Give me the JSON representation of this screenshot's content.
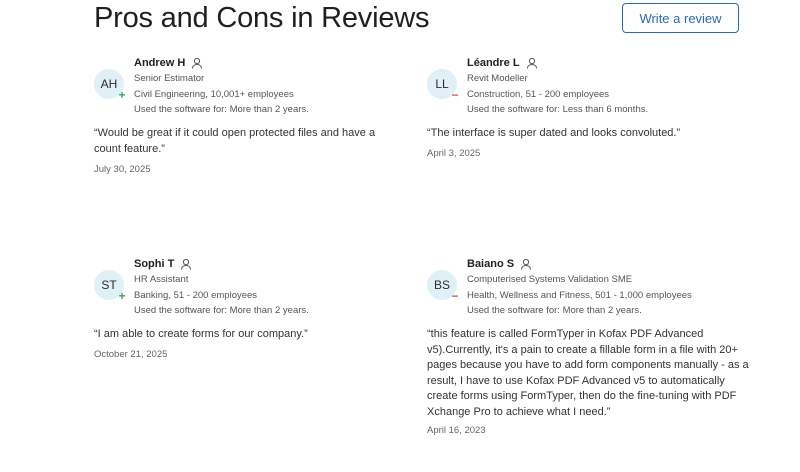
{
  "page": {
    "title": "Pros and Cons in Reviews",
    "write_review_label": "Write a review"
  },
  "reviews": [
    {
      "initials": "AH",
      "sign": "+",
      "name": "Andrew H",
      "role": "Senior Estimator",
      "company": "Civil Engineering, 10,001+ employees",
      "usage": "Used the software for: More than 2 years.",
      "quote": "“Would be great if it could open protected files and have a count feature.”",
      "date": "July 30, 2025"
    },
    {
      "initials": "LL",
      "sign": "−",
      "name": "Léandre L",
      "role": "Revit Modeller",
      "company": "Construction, 51 - 200 employees",
      "usage": "Used the software for: Less than 6 months.",
      "quote": "“The interface is super dated and looks convoluted.”",
      "date": "April 3, 2025"
    },
    {
      "initials": "ST",
      "sign": "+",
      "name": "Sophi T",
      "role": "HR Assistant",
      "company": "Banking, 51 - 200 employees",
      "usage": "Used the software for: More than 2 years.",
      "quote": "“I am able to create forms for our company.”",
      "date": "October 21, 2025"
    },
    {
      "initials": "BS",
      "sign": "−",
      "name": "Baiano S",
      "role": "Computerised Systems Validation SME",
      "company": "Health, Wellness and Fitness, 501 - 1,000 employees",
      "usage": "Used the software for: More than 2 years.",
      "quote": "“this feature is called FormTyper in Kofax PDF Advanced v5).Currently, it's a pain to create a fillable form in a file with 20+ pages because you have to add form components manually - as a result, I have to use Kofax PDF Advanced v5 to automatically create forms using FormTyper, then do the fine-tuning with PDF Xchange Pro to achieve what I need.”",
      "date": "April 16, 2023"
    }
  ]
}
